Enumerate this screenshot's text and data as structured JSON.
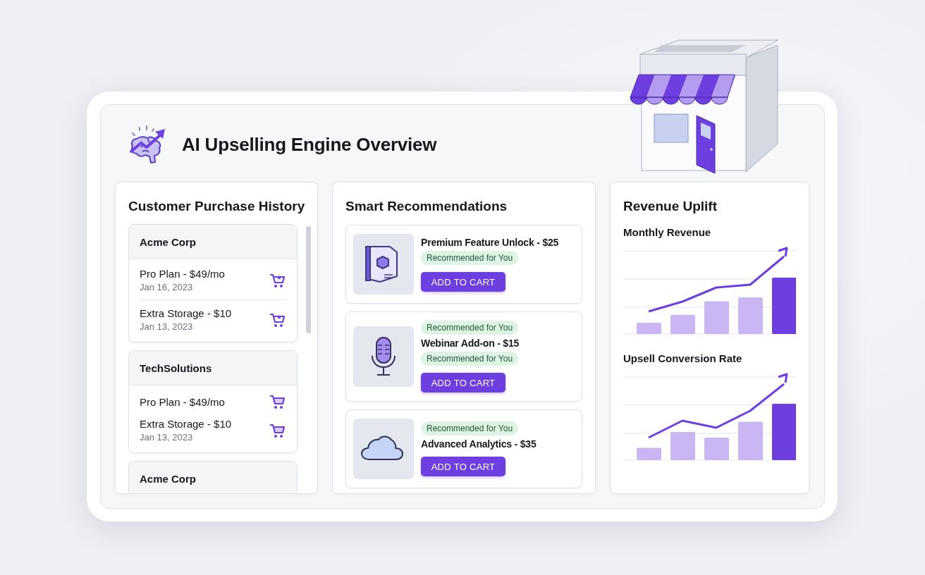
{
  "header": {
    "title": "AI Upselling Engine Overview"
  },
  "purchase_history": {
    "title": "Customer Purchase History",
    "customers": [
      {
        "name": "Acme Corp",
        "purchases": [
          {
            "item": "Pro Plan - $49/mo",
            "date": "Jan 16, 2023"
          },
          {
            "item": "Extra Storage - $10",
            "date": "Jan 13, 2023"
          }
        ]
      },
      {
        "name": "TechSolutions",
        "purchases": [
          {
            "item": "Pro Plan - $49/mo"
          },
          {
            "item": "Extra Storage - $10",
            "date": "Jan 13, 2023"
          }
        ]
      },
      {
        "name": "Acme Corp"
      }
    ]
  },
  "recommendations": {
    "title": "Smart Recommendations",
    "items": [
      {
        "title": "Premium Feature Unlock - $25",
        "badge_below": "Recommended for You",
        "button": "ADD TO CART"
      },
      {
        "badge_above": "Recommended for You",
        "title": "Webinar Add-on - $15",
        "badge_below": "Recommended for You",
        "button": "ADD TO CART"
      },
      {
        "badge_above": "Recommended for You",
        "title": "Advanced Analytics - $35",
        "button": "ADD TO CART"
      }
    ]
  },
  "revenue_uplift": {
    "title": "Revenue Uplift",
    "charts": [
      {
        "title": "Monthly Revenue"
      },
      {
        "title": "Upsell Conversion Rate"
      }
    ]
  }
}
